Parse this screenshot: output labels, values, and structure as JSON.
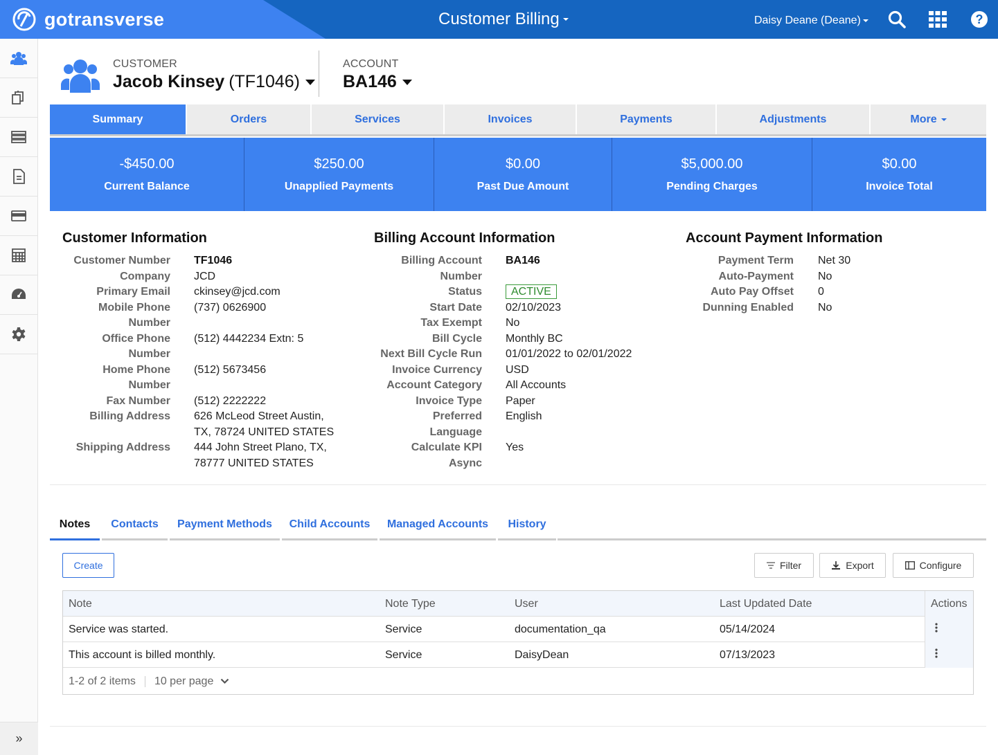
{
  "topbar": {
    "brand": "gotransverse",
    "app_title": "Customer Billing",
    "user": "Daisy Deane (Deane)",
    "icons": [
      "search-icon",
      "apps-grid-icon",
      "help-icon"
    ]
  },
  "sidebar": {
    "items": [
      "customers-icon",
      "catalog-icon",
      "list-icon",
      "document-icon",
      "card-icon",
      "calculator-icon",
      "dashboard-icon",
      "settings-icon"
    ],
    "expand": "»"
  },
  "header": {
    "customer_label": "CUSTOMER",
    "customer_name": "Jacob Kinsey",
    "customer_id": "(TF1046)",
    "account_label": "ACCOUNT",
    "account_id": "BA146"
  },
  "tabs": [
    "Summary",
    "Orders",
    "Services",
    "Invoices",
    "Payments",
    "Adjustments",
    "More"
  ],
  "kpis": [
    {
      "value": "-$450.00",
      "label": "Current Balance"
    },
    {
      "value": "$250.00",
      "label": "Unapplied Payments"
    },
    {
      "value": "$0.00",
      "label": "Past Due Amount"
    },
    {
      "value": "$5,000.00",
      "label": "Pending Charges"
    },
    {
      "value": "$0.00",
      "label": "Invoice Total"
    }
  ],
  "customer_info": {
    "title": "Customer Information",
    "customer_number_label": "Customer Number",
    "customer_number": "TF1046",
    "company_label": "Company",
    "company": "JCD",
    "primary_email_label": "Primary Email",
    "primary_email": "ckinsey@jcd.com",
    "mobile_label_1": "Mobile Phone",
    "mobile_label_2": "Number",
    "mobile": "(737) 0626900",
    "office_label_1": "Office Phone",
    "office_label_2": "Number",
    "office": "(512) 4442234 Extn: 5",
    "home_label_1": "Home Phone",
    "home_label_2": "Number",
    "home": "(512) 5673456",
    "fax_label": "Fax Number",
    "fax": "(512) 2222222",
    "billing_address_label": "Billing Address",
    "billing_address_1": "626 McLeod Street Austin,",
    "billing_address_2": "TX, 78724 UNITED STATES",
    "shipping_address_label": "Shipping Address",
    "shipping_address_1": "444 John Street Plano, TX,",
    "shipping_address_2": "78777 UNITED STATES"
  },
  "billing_info": {
    "title": "Billing Account Information",
    "billing_account_label_1": "Billing Account",
    "billing_account_label_2": "Number",
    "billing_account": "BA146",
    "status_label": "Status",
    "status": "ACTIVE",
    "start_date_label": "Start Date",
    "start_date": "02/10/2023",
    "tax_exempt_label": "Tax Exempt",
    "tax_exempt": "No",
    "bill_cycle_label": "Bill Cycle",
    "bill_cycle": "Monthly BC",
    "next_run_label": "Next Bill Cycle Run",
    "next_run": "01/01/2022 to 02/01/2022",
    "currency_label": "Invoice Currency",
    "currency": "USD",
    "category_label": "Account Category",
    "category": "All Accounts",
    "invoice_type_label": "Invoice Type",
    "invoice_type": "Paper",
    "language_label_1": "Preferred",
    "language_label_2": "Language",
    "language": "English",
    "kpi_label_1": "Calculate KPI",
    "kpi_label_2": "Async",
    "kpi": "Yes"
  },
  "payment_info": {
    "title": "Account Payment Information",
    "term_label": "Payment Term",
    "term": "Net 30",
    "autopay_label": "Auto-Payment",
    "autopay": "No",
    "offset_label": "Auto Pay Offset",
    "offset": "0",
    "dunning_label": "Dunning Enabled",
    "dunning": "No"
  },
  "sub_tabs": [
    "Notes",
    "Contacts",
    "Payment Methods",
    "Child Accounts",
    "Managed Accounts",
    "History"
  ],
  "toolbar": {
    "create": "Create",
    "filter": "Filter",
    "export": "Export",
    "configure": "Configure"
  },
  "grid": {
    "columns": [
      "Note",
      "Note Type",
      "User",
      "Last Updated Date",
      "Actions"
    ],
    "rows": [
      [
        "Service was started.",
        "Service",
        "documentation_qa",
        "05/14/2024"
      ],
      [
        "This account is billed monthly.",
        "Service",
        "DaisyDean",
        "07/13/2023"
      ]
    ],
    "pager_count": "1-2 of 2 items",
    "per_page": "10 per page"
  }
}
